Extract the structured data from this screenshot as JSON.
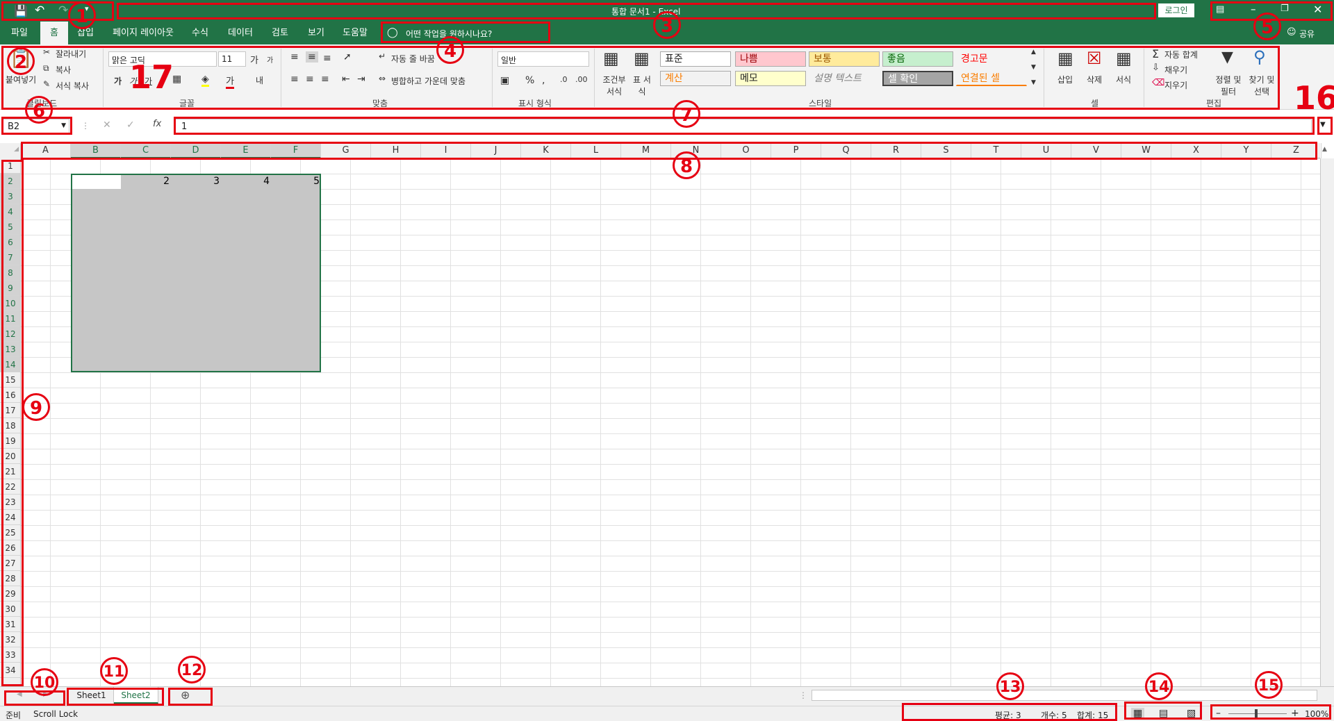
{
  "app": {
    "title": "통합 문서1 - Excel",
    "login": "로그인",
    "share": "공유"
  },
  "tabs": [
    "파일",
    "홈",
    "삽입",
    "페이지 레이아웃",
    "수식",
    "데이터",
    "검토",
    "보기",
    "도움말"
  ],
  "active_tab": "홈",
  "tell_me": "어떤 작업을 원하시나요?",
  "clipboard": {
    "paste": "붙여넣기",
    "cut": "잘라내기",
    "copy": "복사",
    "format_painter": "서식 복사",
    "label": "클립보드"
  },
  "font": {
    "name": "맑은 고딕",
    "size": "11",
    "label": "글꼴"
  },
  "alignment": {
    "wrap": "자동 줄 바꿈",
    "merge": "병합하고 가운데 맞춤",
    "label": "맞춤"
  },
  "number": {
    "format": "일반",
    "label": "표시 형식"
  },
  "styles": {
    "conditional": "조건부 서식",
    "table": "표 서식",
    "label": "스타일",
    "items": [
      "표준",
      "나쁨",
      "보통",
      "좋음",
      "경고문",
      "계산",
      "메모",
      "설명 텍스트",
      "셀 확인",
      "연결된 셀"
    ],
    "colors": {
      "bad_bg": "#ffc7ce",
      "bad_fg": "#9c0006",
      "neutral_bg": "#ffeb9c",
      "neutral_fg": "#9c5700",
      "good_bg": "#c6efce",
      "good_fg": "#006100",
      "warning_fg": "#ff0000",
      "calc_bg": "#f2f2f2",
      "calc_fg": "#fa7d00",
      "note_bg": "#ffffcc",
      "check_bg": "#a5a5a5",
      "linked_fg": "#fa7d00"
    }
  },
  "cells_group": {
    "insert": "삽입",
    "delete": "삭제",
    "format": "서식",
    "label": "셀"
  },
  "editing": {
    "autosum": "자동 합계",
    "fill": "채우기",
    "clear": "지우기",
    "sort": "정렬 및 필터",
    "find": "찾기 및 선택",
    "label": "편집"
  },
  "formula_bar": {
    "name_box": "B2",
    "value": "1",
    "fx": "fx"
  },
  "columns": [
    "A",
    "B",
    "C",
    "D",
    "E",
    "F",
    "G",
    "H",
    "I",
    "J",
    "K",
    "L",
    "M",
    "N",
    "O",
    "P",
    "Q",
    "R",
    "S",
    "T",
    "U",
    "V",
    "W",
    "X",
    "Y",
    "Z"
  ],
  "rows": [
    "1",
    "2",
    "3",
    "4",
    "5",
    "6",
    "7",
    "8",
    "9",
    "10",
    "11",
    "12",
    "13",
    "14",
    "15",
    "16",
    "17",
    "18",
    "19",
    "20",
    "21",
    "22",
    "23",
    "24",
    "25",
    "26",
    "27",
    "28",
    "29",
    "30",
    "31",
    "32",
    "33",
    "34"
  ],
  "cell_values": [
    "1",
    "2",
    "3",
    "4",
    "5"
  ],
  "sheets": [
    "Sheet1",
    "Sheet2"
  ],
  "active_sheet": "Sheet2",
  "status": {
    "ready": "준비",
    "scroll_lock": "Scroll Lock",
    "average": "평균: 3",
    "count": "개수: 5",
    "sum": "합계: 15",
    "zoom": "100%"
  },
  "annotations": [
    "1",
    "2",
    "3",
    "4",
    "5",
    "6",
    "7",
    "8",
    "9",
    "10",
    "11",
    "12",
    "13",
    "14",
    "15",
    "16",
    "17"
  ],
  "accent": "#217346",
  "annotation_color": "#e60012"
}
